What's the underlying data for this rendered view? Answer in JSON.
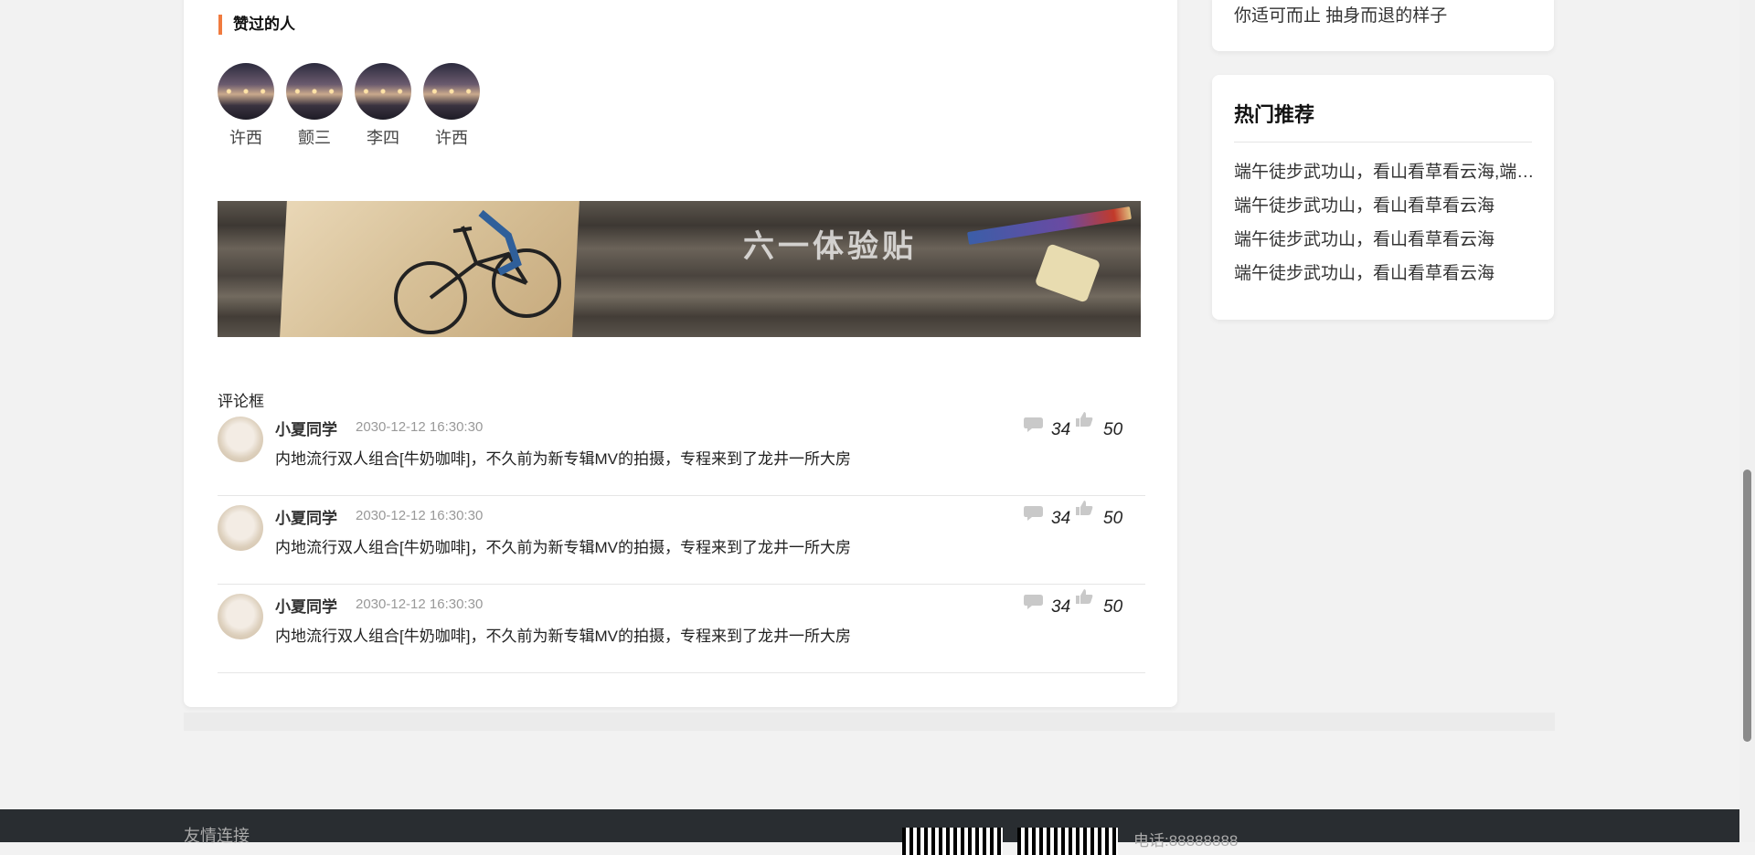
{
  "liked_section": {
    "title": "赞过的人",
    "users": [
      {
        "name": "许西"
      },
      {
        "name": "颤三"
      },
      {
        "name": "李四"
      },
      {
        "name": "许西"
      }
    ]
  },
  "banner": {
    "text": "六一体验贴"
  },
  "comments_section": {
    "label": "评论框",
    "items": [
      {
        "user": "小夏同学",
        "time": "2030-12-12 16:30:30",
        "text": "内地流行双人组合[牛奶咖啡]，不久前为新专辑MV的拍摄，专程来到了龙井一所大房",
        "comment_count": "34",
        "like_count": "50"
      },
      {
        "user": "小夏同学",
        "time": "2030-12-12 16:30:30",
        "text": "内地流行双人组合[牛奶咖啡]，不久前为新专辑MV的拍摄，专程来到了龙井一所大房",
        "comment_count": "34",
        "like_count": "50"
      },
      {
        "user": "小夏同学",
        "time": "2030-12-12 16:30:30",
        "text": "内地流行双人组合[牛奶咖啡]，不久前为新专辑MV的拍摄，专程来到了龙井一所大房",
        "comment_count": "34",
        "like_count": "50"
      }
    ]
  },
  "sidebar": {
    "top_text": "你适可而止 抽身而退的样子",
    "hot": {
      "title": "热门推荐",
      "items": [
        "端午徒步武功山，看山看草看云海,端午徒步武功山",
        "端午徒步武功山，看山看草看云海",
        "端午徒步武功山，看山看草看云海",
        "端午徒步武功山，看山看草看云海"
      ]
    }
  },
  "footer": {
    "links_title": "友情连接",
    "phone": "电话:88888888"
  },
  "colors": {
    "accent": "#f07b3f",
    "footer_bg": "#292d31"
  }
}
